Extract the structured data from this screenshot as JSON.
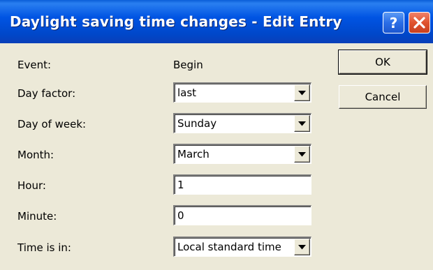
{
  "window": {
    "title": "Daylight saving time changes - Edit Entry",
    "help_symbol": "?"
  },
  "icons": {
    "help": "help-icon",
    "close": "close-icon",
    "dropdown": "chevron-down-icon"
  },
  "colors": {
    "titlebar": "#0054e3",
    "close_button": "#e0532e",
    "dialog_background": "#ece9d8"
  },
  "form": {
    "event": {
      "label": "Event:",
      "value": "Begin"
    },
    "day_factor": {
      "label": "Day factor:",
      "value": "last"
    },
    "day_of_week": {
      "label": "Day of week:",
      "value": "Sunday"
    },
    "month": {
      "label": "Month:",
      "value": "March"
    },
    "hour": {
      "label": "Hour:",
      "value": "1"
    },
    "minute": {
      "label": "Minute:",
      "value": "0"
    },
    "time_is_in": {
      "label": "Time is in:",
      "value": "Local standard time"
    }
  },
  "buttons": {
    "ok": "OK",
    "cancel": "Cancel"
  }
}
